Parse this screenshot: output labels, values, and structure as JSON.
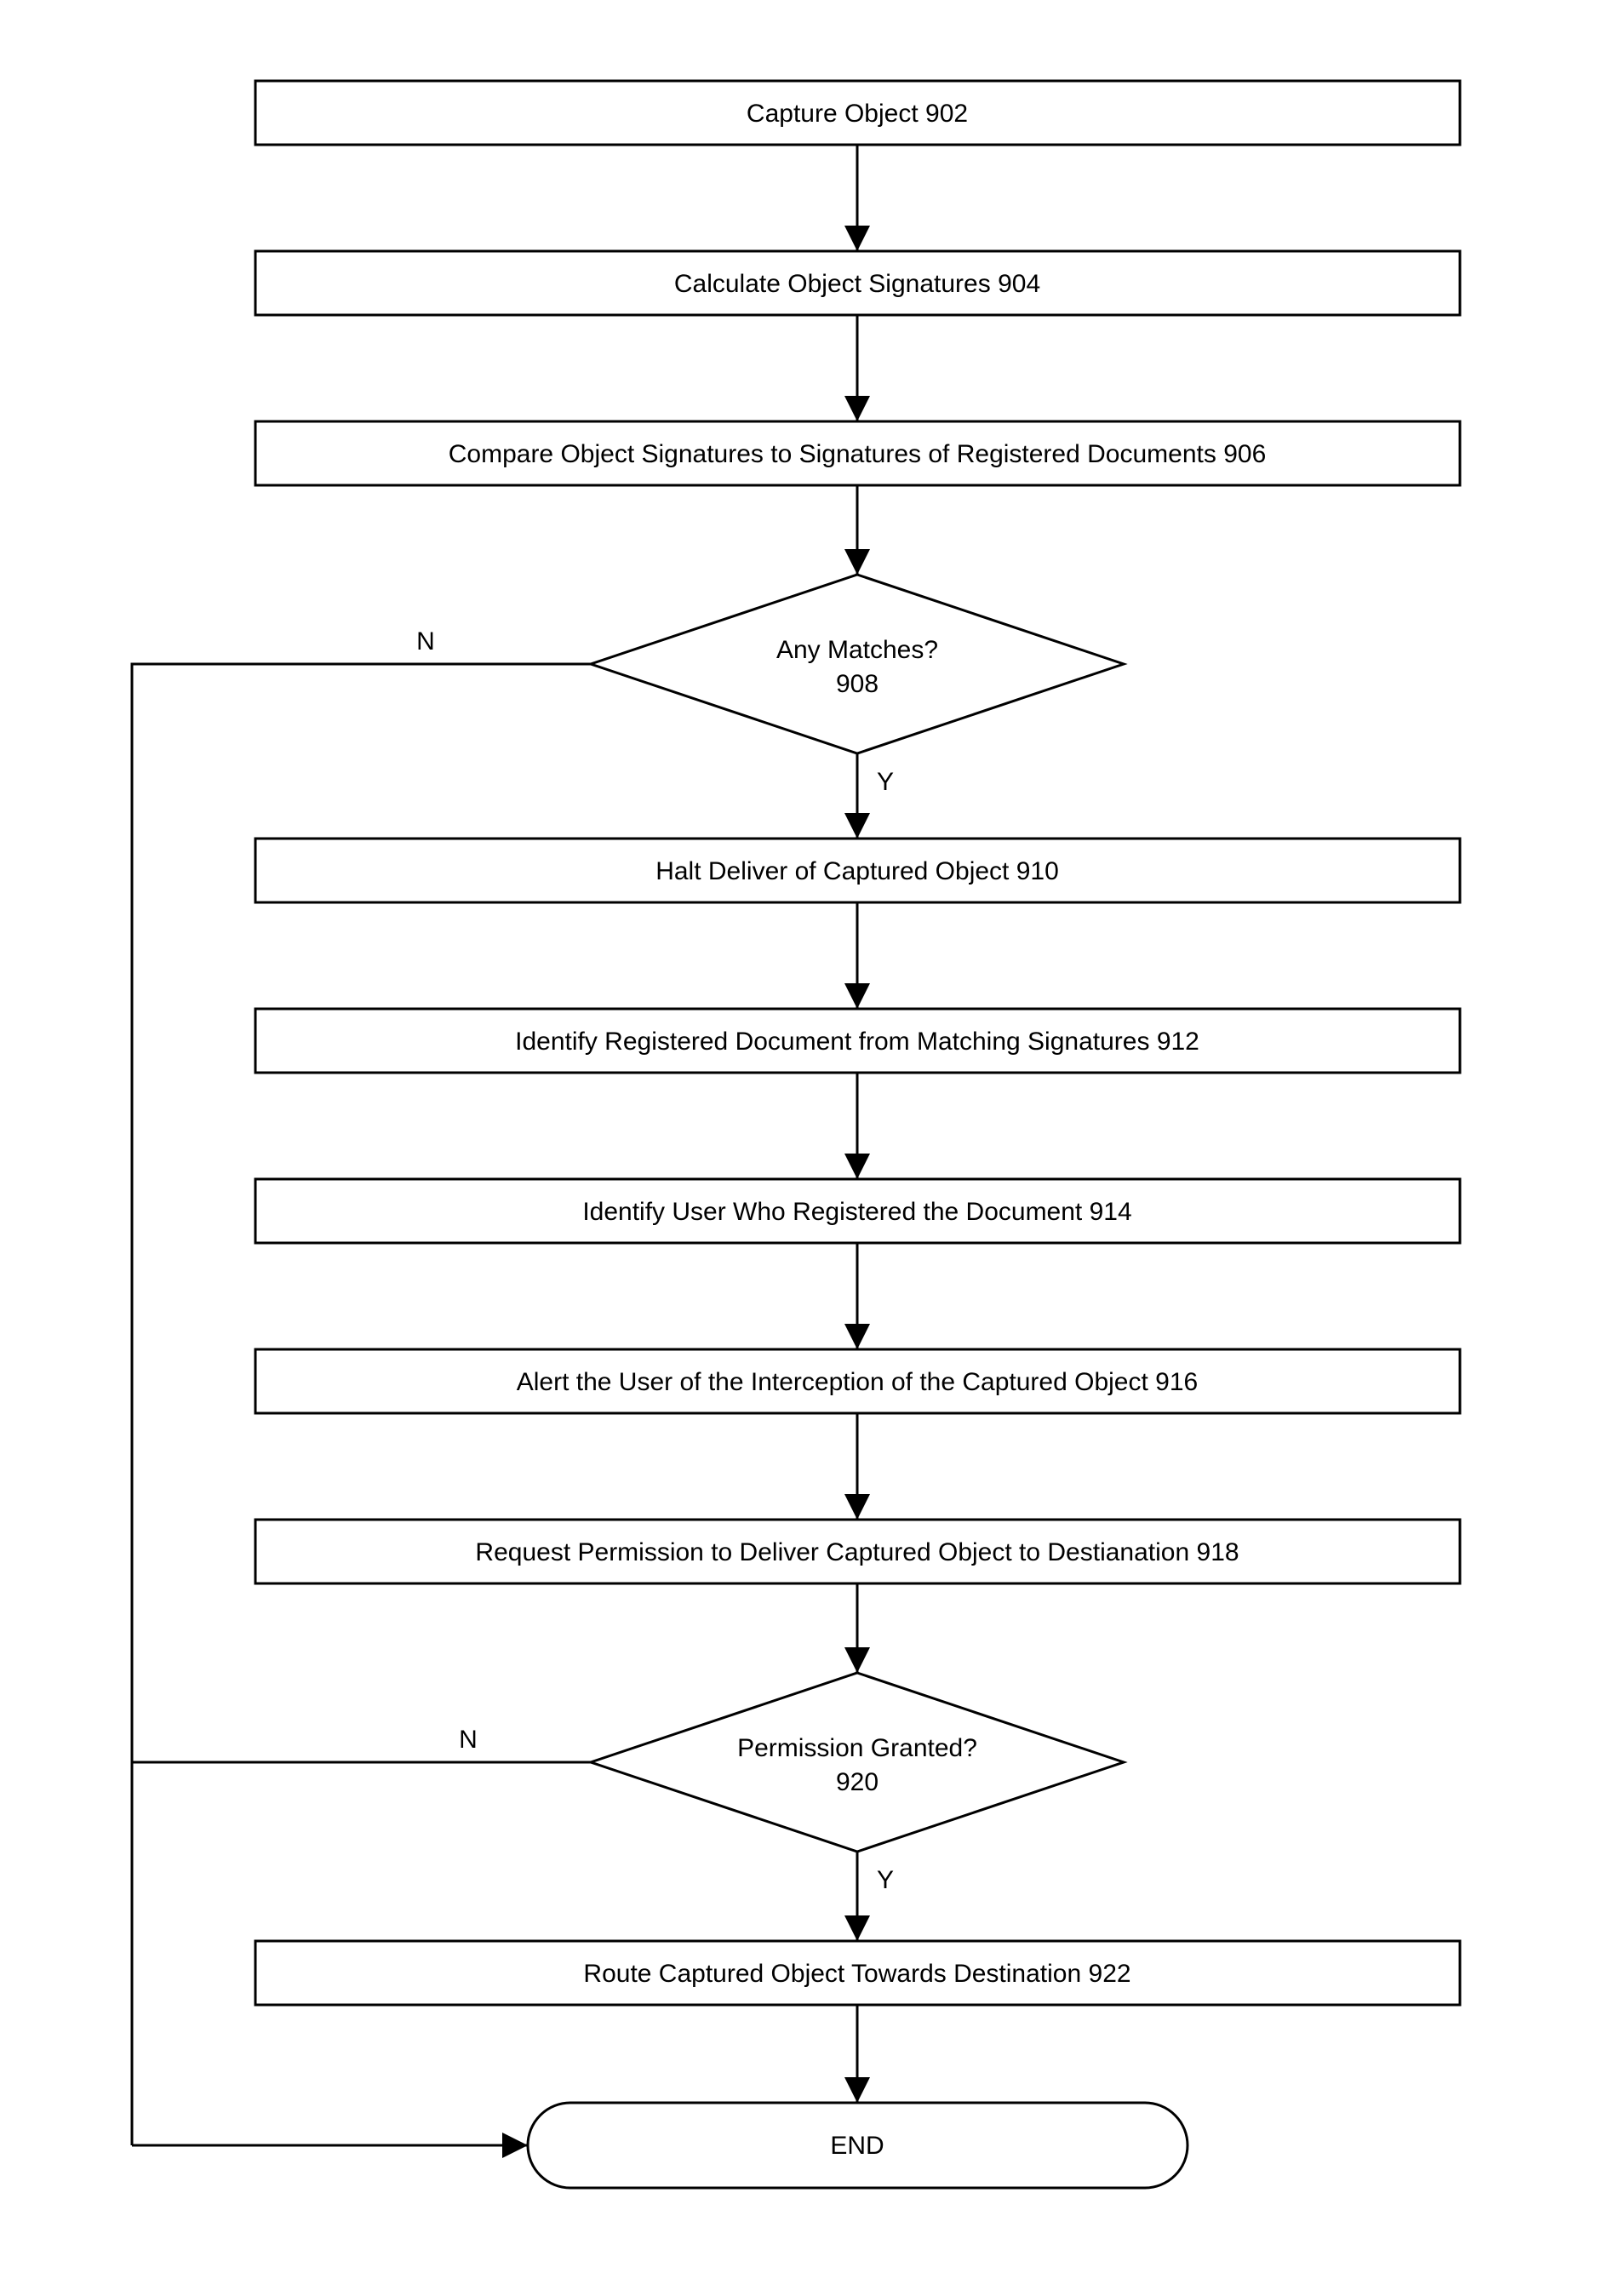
{
  "nodes": {
    "n902": {
      "text": "Capture Object",
      "ref": "902"
    },
    "n904": {
      "text": "Calculate Object Signatures",
      "ref": "904"
    },
    "n906": {
      "text": "Compare Object Signatures to Signatures of Registered Documents",
      "ref": "906"
    },
    "n908": {
      "text": "Any Matches?",
      "ref": "908"
    },
    "n910": {
      "text": "Halt Deliver of Captured Object",
      "ref": "910"
    },
    "n912": {
      "text": "Identify Registered Document from Matching Signatures",
      "ref": "912"
    },
    "n914": {
      "text": "Identify User Who Registered the Document",
      "ref": "914"
    },
    "n916": {
      "text": "Alert the User of the Interception of the Captured Object",
      "ref": "916"
    },
    "n918": {
      "text": "Request Permission to Deliver Captured Object to Destianation",
      "ref": "918"
    },
    "n920": {
      "text": "Permission Granted?",
      "ref": "920"
    },
    "n922": {
      "text": "Route Captured Object Towards Destination",
      "ref": "922"
    },
    "end": {
      "text": "END"
    }
  },
  "edges": {
    "n908_no": "N",
    "n908_yes": "Y",
    "n920_no": "N",
    "n920_yes": "Y"
  }
}
